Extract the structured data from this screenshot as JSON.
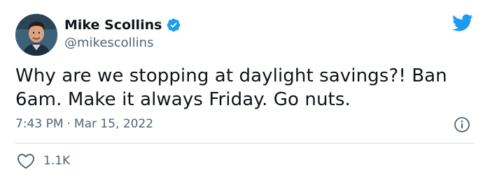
{
  "tweet": {
    "author": {
      "display_name": "Mike Scollins",
      "handle": "@mikescollins",
      "verified": true,
      "avatar_icon": "avatar-photo"
    },
    "text": "Why are we stopping at daylight savings?! Ban 6am. Make it always Friday. Go nuts.",
    "time": "7:43 PM",
    "separator": "·",
    "date": "Mar 15, 2022",
    "likes": "1.1K"
  },
  "icons": {
    "verified": "verified-badge-icon",
    "brand": "twitter-bird-icon",
    "info": "info-icon",
    "like": "heart-icon"
  },
  "colors": {
    "brand": "#1d9bf0",
    "text": "#0f1419",
    "secondary": "#536471",
    "divider": "#cfd9de"
  }
}
